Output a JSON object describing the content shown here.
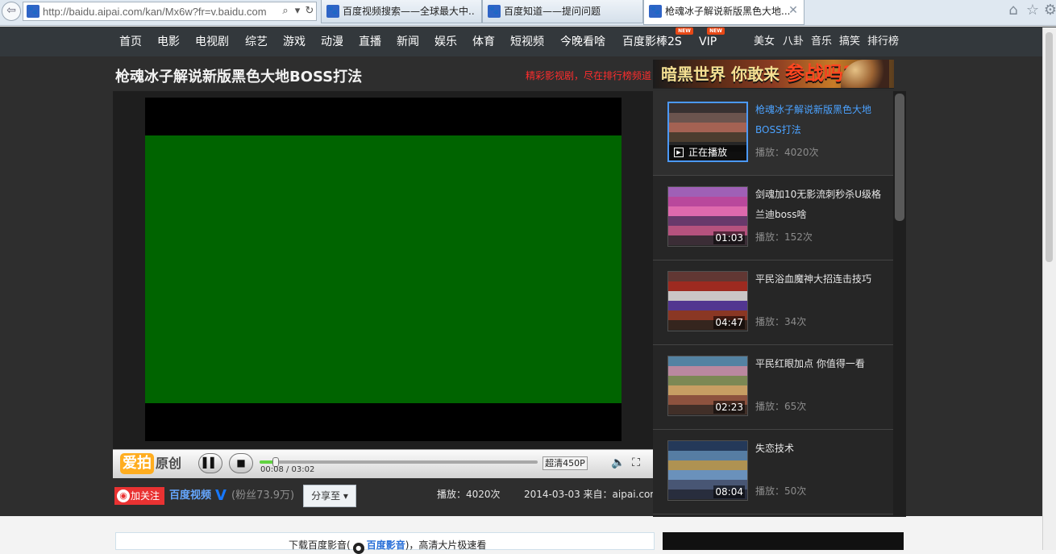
{
  "browser": {
    "url": "http://baidu.aipai.com/kan/Mx6w?fr=v.baidu.com",
    "tabs": [
      {
        "label": "百度视频搜索——全球最大中..."
      },
      {
        "label": "百度知道——提问问题"
      },
      {
        "label": "枪魂冰子解说新版黑色大地..."
      }
    ],
    "close_glyph": "✕"
  },
  "nav": {
    "items": [
      "首页",
      "电影",
      "电视剧",
      "综艺",
      "游戏",
      "动漫",
      "直播",
      "新闻",
      "娱乐",
      "体育",
      "短视频",
      "今晚看啥",
      "百度影棒2S",
      "VIP"
    ],
    "right_items": [
      "美女",
      "八卦",
      "音乐",
      "搞笑",
      "排行榜"
    ],
    "badge": "NEW"
  },
  "page": {
    "title": "枪魂冰子解说新版黑色大地BOSS打法",
    "promo_text": "精彩影视剧，尽在排行榜频道",
    "banner": {
      "text_left": "暗黑世界",
      "text_mid": "你敢来",
      "text_hot": "参战吗?"
    }
  },
  "player": {
    "logo_brand": "爱拍",
    "logo_sub": "原创",
    "time": "00:08 / 03:02",
    "progress": 0.05,
    "quality": "超清450P",
    "controls": {
      "pause": "▌▌",
      "stop": "■",
      "volume": "🔈",
      "fullscreen": "⛶"
    }
  },
  "meta": {
    "follow": "加关注",
    "channel": "百度视频",
    "verified": "V",
    "fans": "(粉丝73.9万)",
    "share": "分享至 ▾",
    "plays": "播放：4020次",
    "date_source": "2014-03-03 来自：aipai.com"
  },
  "sidebar": {
    "now_playing": "正在播放",
    "items": [
      {
        "title": "枪魂冰子解说新版黑色大地BOSS打法",
        "views": "播放：4020次",
        "time": "",
        "active": true
      },
      {
        "title": "剑魂加10无影流刺秒杀U级格兰迪boss啥",
        "views": "播放：152次",
        "time": "01:03",
        "active": false
      },
      {
        "title": "平民浴血魔神大招连击技巧",
        "views": "播放：34次",
        "time": "04:47",
        "active": false
      },
      {
        "title": "平民红眼加点 你值得一看",
        "views": "播放：65次",
        "time": "02:23",
        "active": false
      },
      {
        "title": "失恋技术",
        "views": "播放：50次",
        "time": "08:04",
        "active": false
      }
    ]
  },
  "bottom": {
    "download_prefix": "下载百度影音(",
    "download_brand": "百度影音",
    "download_suffix": ")，高清大片极速看"
  },
  "colors": {
    "nav_bg": "#33383c",
    "main_bg": "#2e2e2e",
    "video_green": "#006400",
    "accent_blue": "#4ba2ff",
    "promo_red": "#ff2d2d"
  }
}
